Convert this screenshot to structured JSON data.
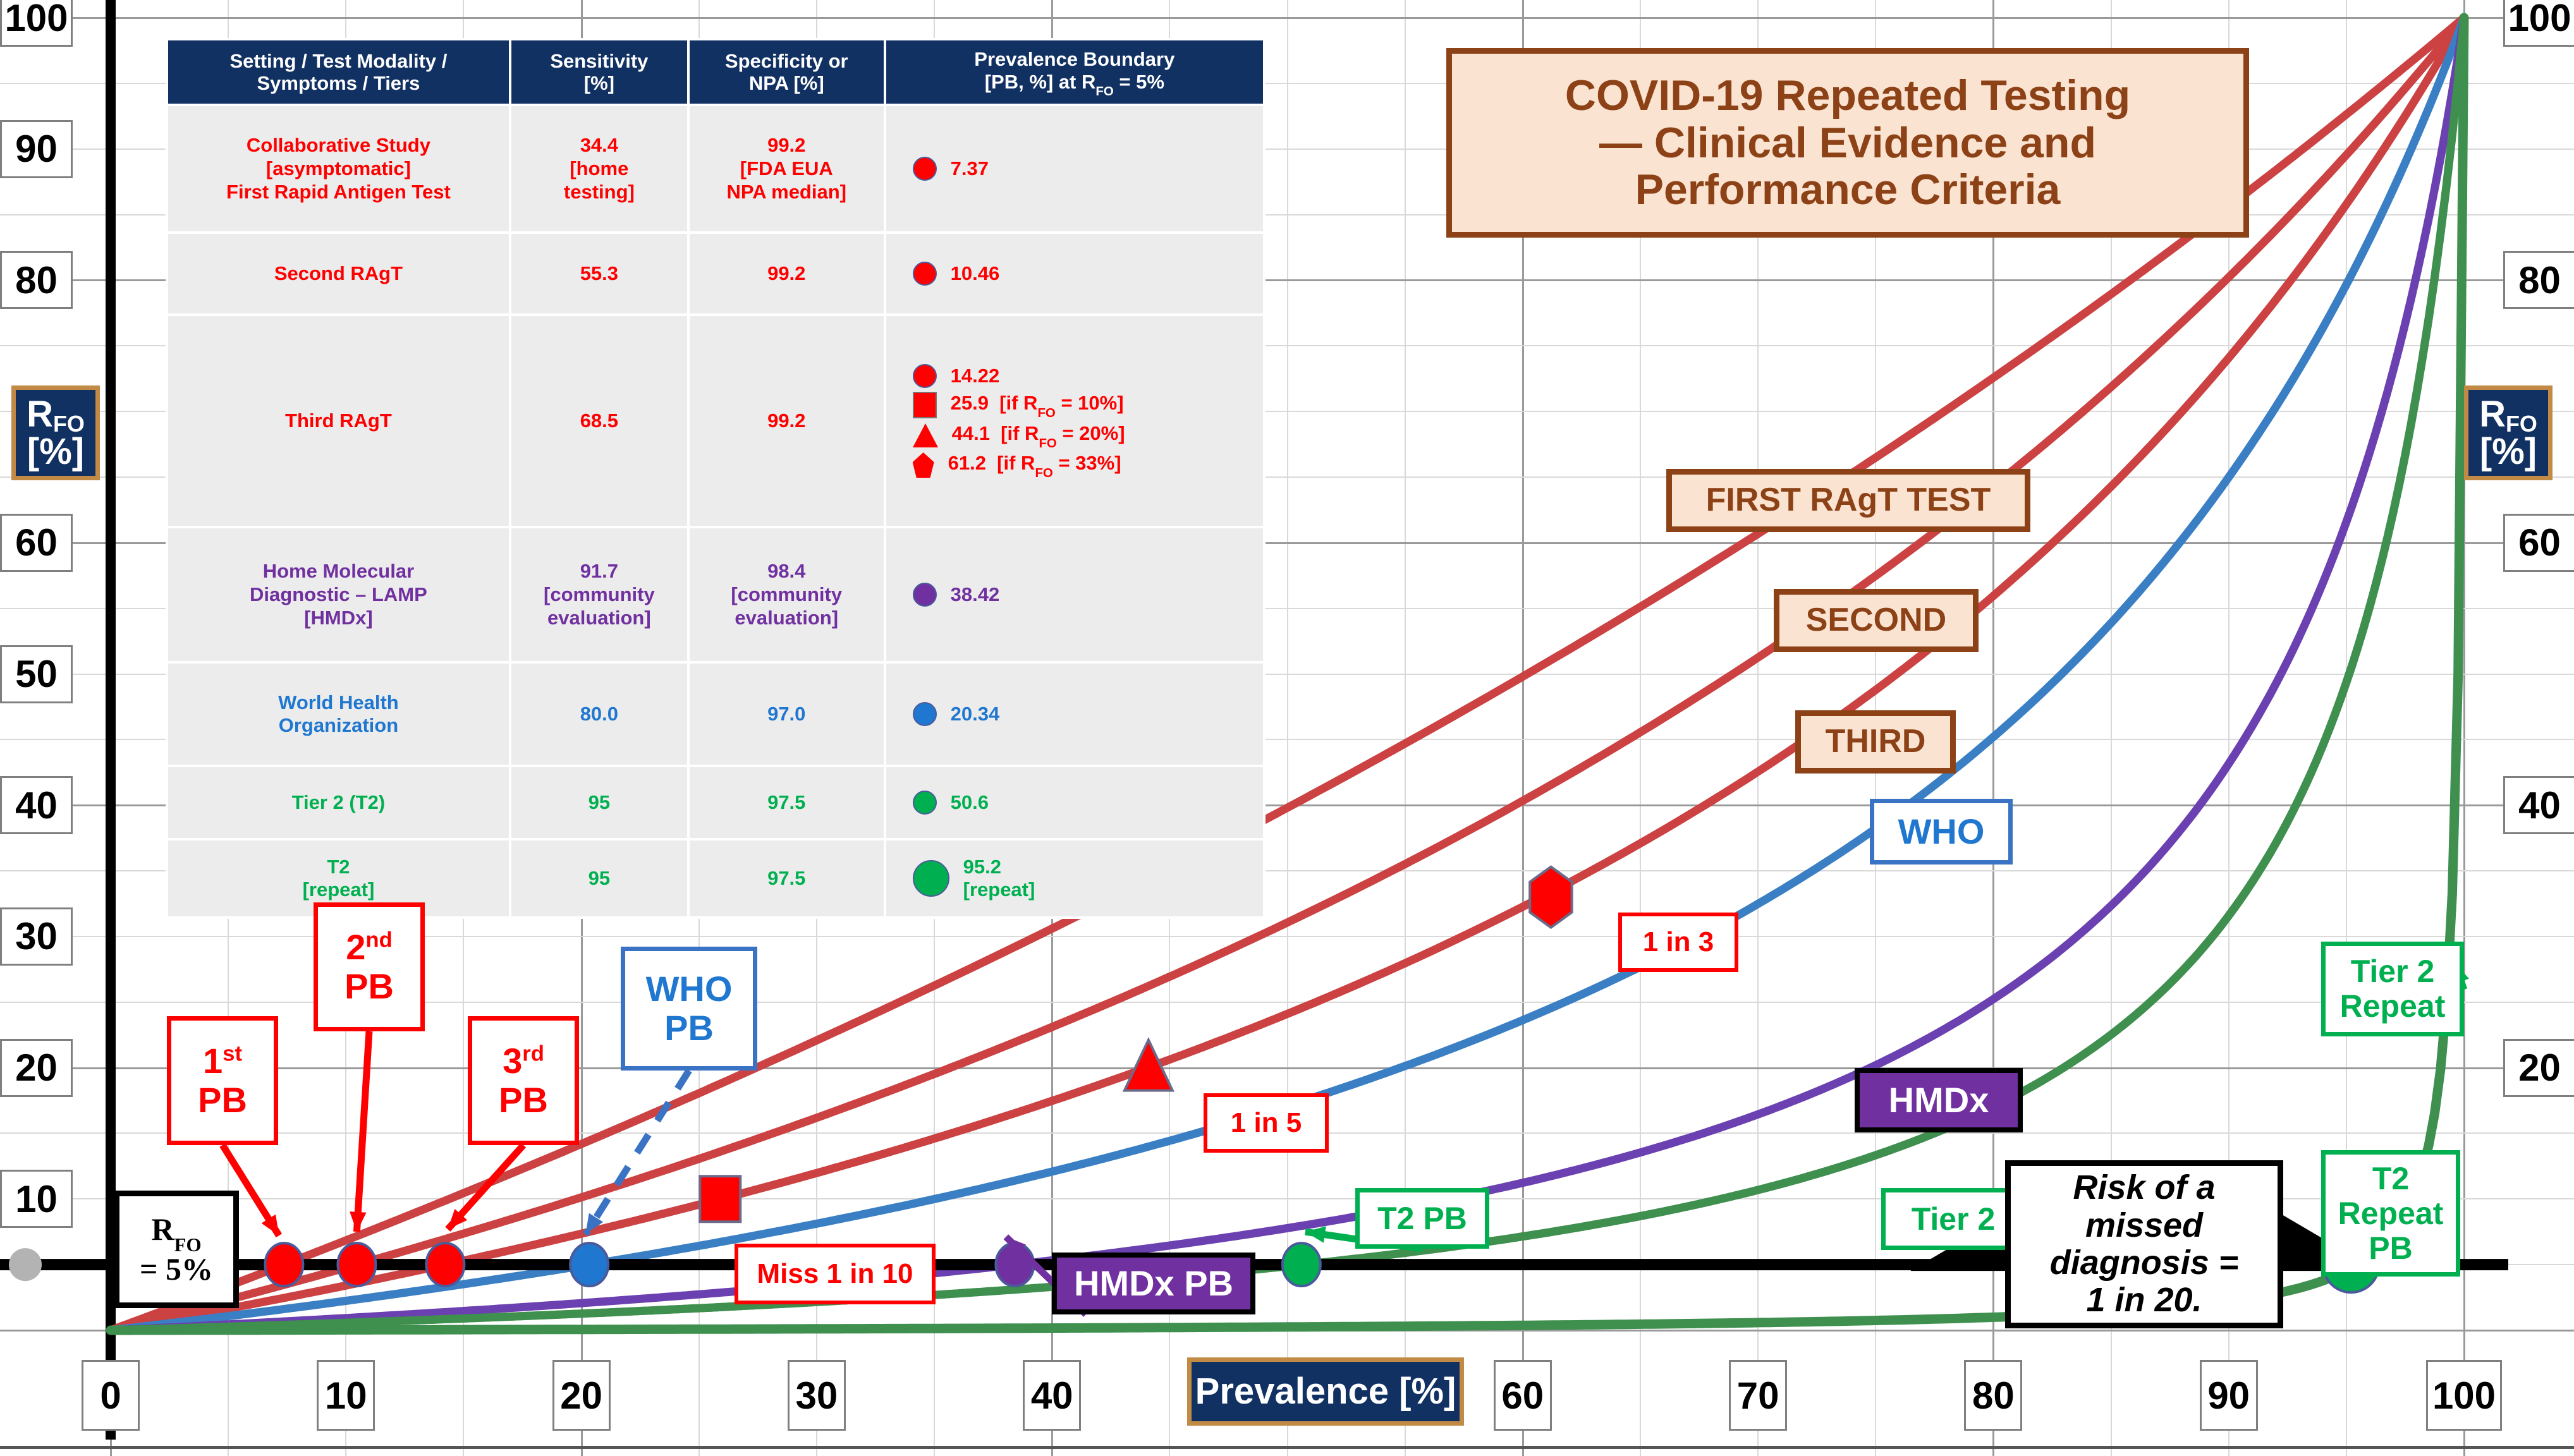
{
  "title": {
    "line1": "COVID-19 Repeated Testing",
    "line2": "— Clinical Evidence and",
    "line3": "Performance Criteria"
  },
  "axes": {
    "x_title": "Prevalence [%]",
    "y_title_main": "R",
    "y_title_sub": "FO",
    "y_title_unit": "[%]",
    "x_ticks": [
      "0",
      "10",
      "20",
      "30",
      "40",
      "60",
      "70",
      "80",
      "90",
      "100"
    ],
    "y_ticks_left": [
      "100",
      "90",
      "80",
      "60",
      "50",
      "40",
      "30",
      "20",
      "10"
    ],
    "y_ticks_right": [
      "100",
      "80",
      "60",
      "40",
      "20"
    ],
    "xlim": [
      0,
      100
    ],
    "ylim": [
      0,
      100
    ]
  },
  "table": {
    "headers": [
      {
        "l1": "Setting / Test Modality /",
        "l2": "Symptoms / Tiers"
      },
      {
        "l1": "Sensitivity",
        "l2": "[%]"
      },
      {
        "l1": "Specificity or",
        "l2": "NPA [%]"
      },
      {
        "l1": "Prevalence Boundary",
        "l2": "[PB, %] at R",
        "sub": "FO",
        "l3": " = 5%"
      }
    ],
    "rows": [
      {
        "color": "c-red",
        "setting": [
          "Collaborative Study",
          "[asymptomatic]",
          "First Rapid Antigen Test"
        ],
        "sensitivity": [
          "34.4",
          "[home",
          "testing]"
        ],
        "specificity": [
          "99.2",
          "[FDA EUA",
          "NPA median]"
        ],
        "pb": [
          {
            "sym": "circle",
            "value": "7.37",
            "note": ""
          }
        ]
      },
      {
        "color": "c-red",
        "setting": [
          "Second RAgT"
        ],
        "sensitivity": [
          "55.3"
        ],
        "specificity": [
          "99.2"
        ],
        "pb": [
          {
            "sym": "circle",
            "value": "10.46",
            "note": ""
          }
        ]
      },
      {
        "color": "c-red",
        "setting": [
          "Third RAgT"
        ],
        "sensitivity": [
          "68.5"
        ],
        "specificity": [
          "99.2"
        ],
        "pb": [
          {
            "sym": "circle",
            "value": "14.22",
            "note": ""
          },
          {
            "sym": "square",
            "value": "25.9",
            "note": "[if R_FO = 10%]"
          },
          {
            "sym": "tri",
            "value": "44.1",
            "note": "[if R_FO = 20%]"
          },
          {
            "sym": "pent",
            "value": "61.2",
            "note": "[if R_FO = 33%]"
          }
        ]
      },
      {
        "color": "c-purple",
        "setting": [
          "Home Molecular",
          "Diagnostic – LAMP",
          "[HMDx]"
        ],
        "sensitivity": [
          "91.7",
          "[community",
          "evaluation]"
        ],
        "specificity": [
          "98.4",
          "[community",
          "evaluation]"
        ],
        "pb": [
          {
            "sym": "circle purple",
            "value": "38.42",
            "note": ""
          }
        ]
      },
      {
        "color": "c-blue",
        "setting": [
          "World Health",
          "Organization"
        ],
        "sensitivity": [
          "80.0"
        ],
        "specificity": [
          "97.0"
        ],
        "pb": [
          {
            "sym": "circle blue",
            "value": "20.34",
            "note": ""
          }
        ]
      },
      {
        "color": "c-green",
        "setting": [
          "Tier 2 (T2)"
        ],
        "sensitivity": [
          "95"
        ],
        "specificity": [
          "97.5"
        ],
        "pb": [
          {
            "sym": "circle green",
            "value": "50.6",
            "note": ""
          }
        ]
      },
      {
        "color": "c-green",
        "setting": [
          "T2",
          "[repeat]"
        ],
        "sensitivity": [
          "95"
        ],
        "specificity": [
          "97.5"
        ],
        "pb": [
          {
            "sym": "circle green big",
            "value": "95.2",
            "note": "[repeat]"
          }
        ]
      }
    ]
  },
  "curve_labels": {
    "first": "FIRST RAgT TEST",
    "second": "SECOND",
    "third": "THIRD",
    "who": "WHO",
    "hmdx": "HMDx",
    "tier2": "Tier 2",
    "tier2_repeat_l1": "Tier 2",
    "tier2_repeat_l2": "Repeat"
  },
  "callouts": {
    "pb1_l1": "1",
    "pb1_sup": "st",
    "pb1_l2": "PB",
    "pb2_l1": "2",
    "pb2_sup": "nd",
    "pb2_l2": "PB",
    "pb3_l1": "3",
    "pb3_sup": "rd",
    "pb3_l2": "PB",
    "who_pb_l1": "WHO",
    "who_pb_l2": "PB",
    "hmdx_pb": "HMDx PB",
    "t2_pb": "T2 PB",
    "t2_repeat_pb_l1": "T2",
    "t2_repeat_pb_l2": "Repeat",
    "t2_repeat_pb_l3": "PB",
    "miss_1_in_10": "Miss 1 in 10",
    "one_in_5": "1 in 5",
    "one_in_3": "1 in 3",
    "rfo5_l1": "R",
    "rfo5_sub": "FO",
    "rfo5_l2": "= 5%",
    "risk_l1": "Risk of a",
    "risk_l2": "missed",
    "risk_l3": "diagnosis =",
    "risk_l4": "1 in 20."
  },
  "colors": {
    "red": "#cc4141",
    "blue": "#3a7fc4",
    "purple": "#6b40b0",
    "green": "#3f8f4f",
    "green_bright": "#00b050",
    "header_navy": "#123163",
    "title_brown": "#8c4216",
    "gold": "#c18a45"
  },
  "chart_data": {
    "type": "line",
    "title": "COVID-19 Repeated Testing — Clinical Evidence and Performance Criteria",
    "xlabel": "Prevalence [%]",
    "ylabel": "R_FO [%]",
    "xlim": [
      0,
      100
    ],
    "ylim": [
      0,
      100
    ],
    "grid": true,
    "legend": "inline curve labels",
    "series": [
      {
        "name": "First RAgT Test",
        "color": "#cc4141",
        "sensitivity": 34.4,
        "specificity": 99.2,
        "pb_at_5": 7.37
      },
      {
        "name": "Second RAgT",
        "color": "#cc4141",
        "sensitivity": 55.3,
        "specificity": 99.2,
        "pb_at_5": 10.46
      },
      {
        "name": "Third RAgT",
        "color": "#cc4141",
        "sensitivity": 68.5,
        "specificity": 99.2,
        "pb_at_5": 14.22,
        "extra_points": [
          {
            "rfo": 10,
            "pb": 25.9
          },
          {
            "rfo": 20,
            "pb": 44.1
          },
          {
            "rfo": 33,
            "pb": 61.2
          }
        ]
      },
      {
        "name": "WHO",
        "color": "#3a7fc4",
        "sensitivity": 80.0,
        "specificity": 97.0,
        "pb_at_5": 20.34
      },
      {
        "name": "HMDx",
        "color": "#6b40b0",
        "sensitivity": 91.7,
        "specificity": 98.4,
        "pb_at_5": 38.42
      },
      {
        "name": "Tier 2",
        "color": "#3f8f4f",
        "sensitivity": 95,
        "specificity": 97.5,
        "pb_at_5": 50.6
      },
      {
        "name": "Tier 2 Repeat",
        "color": "#3f8f4f",
        "sensitivity": 95,
        "specificity": 97.5,
        "pb_at_5": 95.2
      }
    ],
    "reference_line": {
      "label": "R_FO = 5%",
      "y": 5,
      "note": "Risk of a missed diagnosis = 1 in 20."
    },
    "markers_on_reference_line": [
      {
        "x": 7.37,
        "color": "#ff0000",
        "shape": "circle"
      },
      {
        "x": 10.46,
        "color": "#ff0000",
        "shape": "circle"
      },
      {
        "x": 14.22,
        "color": "#ff0000",
        "shape": "circle"
      },
      {
        "x": 20.34,
        "color": "#1f77d0",
        "shape": "circle"
      },
      {
        "x": 38.42,
        "color": "#7030a0",
        "shape": "circle"
      },
      {
        "x": 50.6,
        "color": "#00b050",
        "shape": "circle"
      },
      {
        "x": 95.2,
        "color": "#00b050",
        "shape": "circle-large"
      }
    ],
    "markers_off_reference_line": [
      {
        "x": 25.9,
        "y": 10,
        "color": "#ff0000",
        "shape": "square",
        "label": "Miss 1 in 10"
      },
      {
        "x": 44.1,
        "y": 20,
        "color": "#ff0000",
        "shape": "triangle",
        "label": "1 in 5"
      },
      {
        "x": 61.2,
        "y": 33,
        "color": "#ff0000",
        "shape": "pentagon",
        "label": "1 in 3"
      }
    ]
  }
}
